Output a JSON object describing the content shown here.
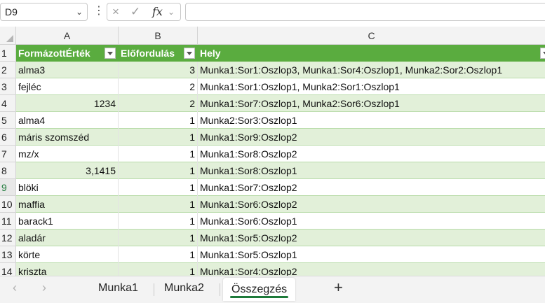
{
  "formula_bar": {
    "name_box": "D9",
    "cancel_icon": "×",
    "enter_icon": "✓",
    "fx_label": "fx",
    "formula_value": ""
  },
  "columns": [
    "A",
    "B",
    "C"
  ],
  "table": {
    "headers": [
      "FormázottÉrték",
      "Előfordulás",
      "Hely"
    ],
    "rows": [
      {
        "num": "2",
        "a": "alma3",
        "a_align": "left",
        "b": "3",
        "c": "Munka1:Sor1:Oszlop3, Munka1:Sor4:Oszlop1, Munka2:Sor2:Oszlop1"
      },
      {
        "num": "3",
        "a": "fejléc",
        "a_align": "left",
        "b": "2",
        "c": "Munka1:Sor1:Oszlop1, Munka2:Sor1:Oszlop1"
      },
      {
        "num": "4",
        "a": "1234",
        "a_align": "right",
        "b": "2",
        "c": "Munka1:Sor7:Oszlop1, Munka2:Sor6:Oszlop1"
      },
      {
        "num": "5",
        "a": "alma4",
        "a_align": "left",
        "b": "1",
        "c": "Munka2:Sor3:Oszlop1"
      },
      {
        "num": "6",
        "a": "máris szomszéd",
        "a_align": "left",
        "b": "1",
        "c": "Munka1:Sor9:Oszlop2"
      },
      {
        "num": "7",
        "a": "mz/x",
        "a_align": "left",
        "b": "1",
        "c": "Munka1:Sor8:Oszlop2"
      },
      {
        "num": "8",
        "a": "3,1415",
        "a_align": "right",
        "b": "1",
        "c": "Munka1:Sor8:Oszlop1"
      },
      {
        "num": "9",
        "a": "blöki",
        "a_align": "left",
        "b": "1",
        "c": "Munka1:Sor7:Oszlop2"
      },
      {
        "num": "10",
        "a": "maffia",
        "a_align": "left",
        "b": "1",
        "c": "Munka1:Sor6:Oszlop2"
      },
      {
        "num": "11",
        "a": "barack1",
        "a_align": "left",
        "b": "1",
        "c": "Munka1:Sor6:Oszlop1"
      },
      {
        "num": "12",
        "a": "aladár",
        "a_align": "left",
        "b": "1",
        "c": "Munka1:Sor5:Oszlop2"
      },
      {
        "num": "13",
        "a": "körte",
        "a_align": "left",
        "b": "1",
        "c": "Munka1:Sor5:Oszlop1"
      },
      {
        "num": "14",
        "a": "kriszta",
        "a_align": "left",
        "b": "1",
        "c": "Munka1:Sor4:Oszlop2"
      }
    ]
  },
  "header_row_num": "1",
  "active_row": "9",
  "sheet_tabs": [
    {
      "label": "Munka1",
      "active": false
    },
    {
      "label": "Munka2",
      "active": false
    },
    {
      "label": "Összegzés",
      "active": true
    }
  ],
  "add_sheet_label": "+",
  "nav_prev": "‹",
  "nav_next": "›",
  "colors": {
    "header_green": "#5aac3f",
    "band_green": "#e2f0d9",
    "active_tab_underline": "#1e7a3a"
  }
}
